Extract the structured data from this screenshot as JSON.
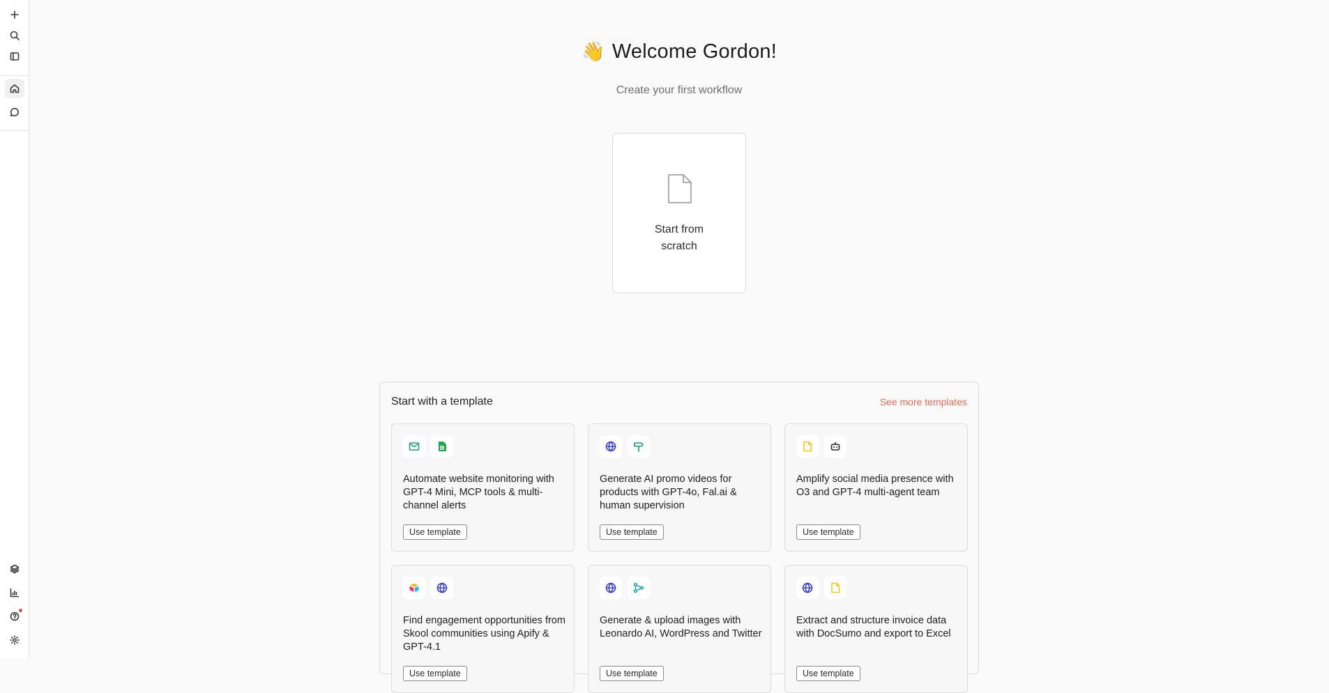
{
  "sidebar": {
    "top_items": [
      {
        "name": "new-icon"
      },
      {
        "name": "search-icon"
      },
      {
        "name": "sidebar-toggle-icon"
      }
    ],
    "nav_items": [
      {
        "name": "home-icon",
        "active": true
      },
      {
        "name": "chat-icon",
        "active": false
      }
    ],
    "bottom_items": [
      {
        "name": "layers-icon"
      },
      {
        "name": "analytics-icon"
      },
      {
        "name": "help-icon",
        "notification": true
      },
      {
        "name": "settings-icon"
      }
    ]
  },
  "header": {
    "wave_emoji": "👋",
    "welcome": "Welcome Gordon!",
    "subtitle": "Create your first workflow"
  },
  "scratch": {
    "line1": "Start from",
    "line2": "scratch"
  },
  "templates": {
    "heading": "Start with a template",
    "see_more": "See more templates",
    "button_label": "Use template",
    "cards": [
      {
        "title": "Automate website monitoring with GPT-4 Mini, MCP tools & multi-channel alerts",
        "icons": [
          "mail-icon",
          "google-sheets-icon"
        ]
      },
      {
        "title": "Generate AI promo videos for products with GPT-4o, Fal.ai & human supervision",
        "icons": [
          "globe-icon",
          "signpost-icon"
        ]
      },
      {
        "title": "Amplify social media presence with O3 and GPT-4 multi-agent team",
        "icons": [
          "sticky-note-icon",
          "robot-icon"
        ]
      },
      {
        "title": "Find engagement opportunities from Skool communities using Apify & GPT-4.1",
        "icons": [
          "airtable-icon",
          "globe-icon"
        ]
      },
      {
        "title": "Generate & upload images with Leonardo AI, WordPress and Twitter",
        "icons": [
          "globe-icon",
          "workflow-icon"
        ]
      },
      {
        "title": "Extract and structure invoice data with DocSumo and export to Excel",
        "icons": [
          "globe-icon",
          "sticky-note-icon"
        ]
      }
    ]
  },
  "colors": {
    "accent_link": "#ef6b50",
    "mail": "#1aa37a",
    "sheets": "#1ea94f",
    "globe": "#3b3fcf",
    "signpost": "#1b9a6c",
    "note": "#f5c518",
    "workflow": "#20a4b8"
  }
}
